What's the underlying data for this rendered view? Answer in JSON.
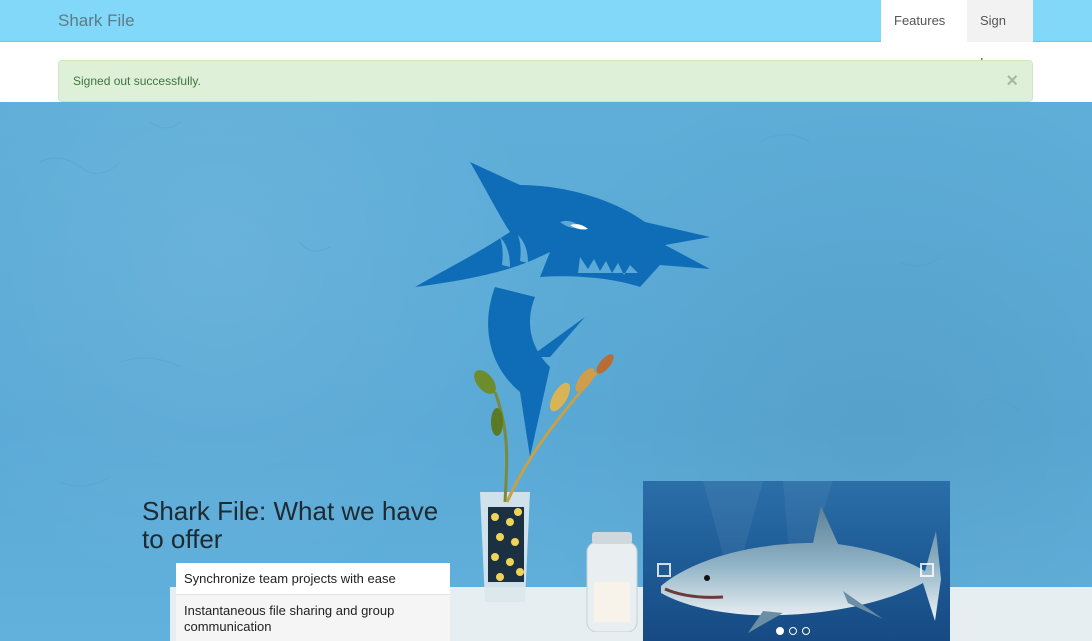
{
  "navbar": {
    "brand": "Shark File",
    "features_label": "Features",
    "signin_label": "Sign In"
  },
  "alert": {
    "message": "Signed out successfully.",
    "close_symbol": "×"
  },
  "hero": {
    "title": "Shark File: What we have to offer",
    "features": [
      "Synchronize team projects with ease",
      "Instantaneous file sharing and group communication"
    ]
  },
  "carousel": {
    "slide_count": 3,
    "active_index": 0
  },
  "colors": {
    "navbar": "#81d8f8",
    "alert_bg": "#dff0d8",
    "alert_text": "#3c763d",
    "hero_bg": "#5aa9d6",
    "logo": "#0f6db8"
  }
}
